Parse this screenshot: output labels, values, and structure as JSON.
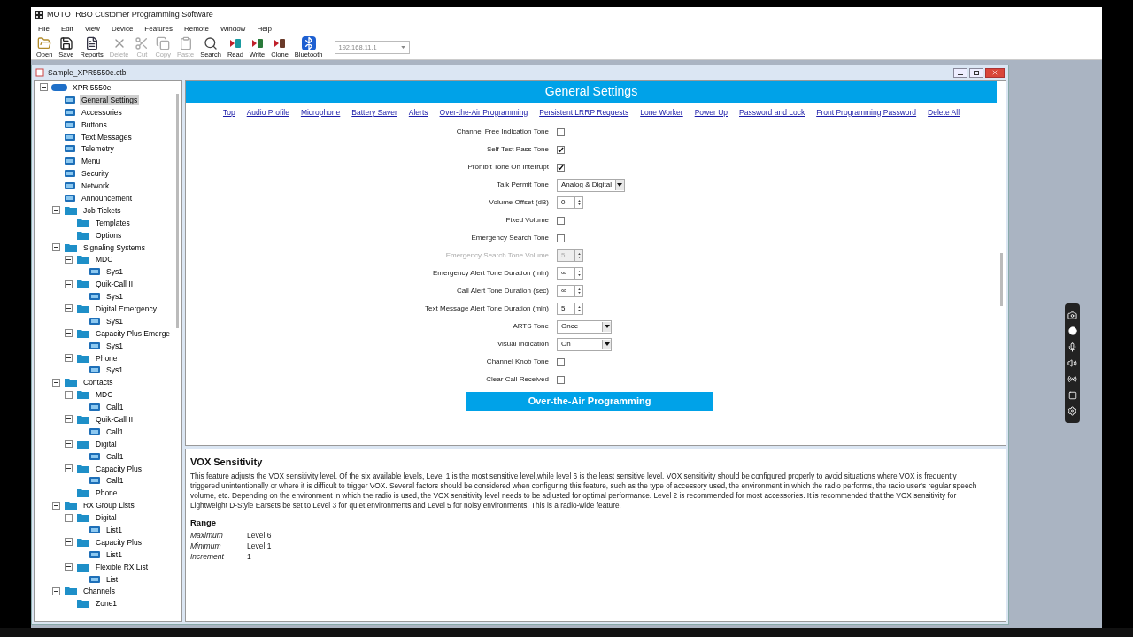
{
  "app": {
    "title": "MOTOTRBO Customer Programming Software"
  },
  "menu": [
    "File",
    "Edit",
    "View",
    "Device",
    "Features",
    "Remote",
    "Window",
    "Help"
  ],
  "toolbar": [
    {
      "label": "Open",
      "kind": "open",
      "disabled": false
    },
    {
      "label": "Save",
      "kind": "save",
      "disabled": false
    },
    {
      "label": "Reports",
      "kind": "reports",
      "disabled": false
    },
    {
      "label": "Delete",
      "kind": "delete",
      "disabled": true
    },
    {
      "label": "Cut",
      "kind": "cut",
      "disabled": true
    },
    {
      "label": "Copy",
      "kind": "copy",
      "disabled": true
    },
    {
      "label": "Paste",
      "kind": "paste",
      "disabled": true
    },
    {
      "label": "Search",
      "kind": "search",
      "disabled": false
    },
    {
      "label": "Read",
      "kind": "read",
      "disabled": false
    },
    {
      "label": "Write",
      "kind": "write",
      "disabled": false
    },
    {
      "label": "Clone",
      "kind": "clone",
      "disabled": false
    },
    {
      "label": "Bluetooth",
      "kind": "bluetooth",
      "disabled": false
    }
  ],
  "address": {
    "value": "192.168.11.1"
  },
  "document": {
    "title": "Sample_XPR5550e.ctb"
  },
  "tree": [
    {
      "label": "XPR 5550e",
      "kind": "radio",
      "selected": false,
      "children": [
        {
          "label": "General Settings",
          "kind": "item",
          "selected": true
        },
        {
          "label": "Accessories",
          "kind": "item",
          "selected": false
        },
        {
          "label": "Buttons",
          "kind": "item",
          "selected": false
        },
        {
          "label": "Text Messages",
          "kind": "item",
          "selected": false
        },
        {
          "label": "Telemetry",
          "kind": "item",
          "selected": false
        },
        {
          "label": "Menu",
          "kind": "item",
          "selected": false
        },
        {
          "label": "Security",
          "kind": "item",
          "selected": false
        },
        {
          "label": "Network",
          "kind": "item",
          "selected": false
        },
        {
          "label": "Announcement",
          "kind": "item",
          "selected": false
        },
        {
          "label": "Job Tickets",
          "kind": "folder",
          "selected": false,
          "children": [
            {
              "label": "Templates",
              "kind": "folder",
              "selected": false
            },
            {
              "label": "Options",
              "kind": "folder",
              "selected": false
            }
          ]
        },
        {
          "label": "Signaling Systems",
          "kind": "folder",
          "selected": false,
          "children": [
            {
              "label": "MDC",
              "kind": "folder",
              "selected": false,
              "children": [
                {
                  "label": "Sys1",
                  "kind": "item",
                  "selected": false
                }
              ]
            },
            {
              "label": "Quik-Call II",
              "kind": "folder",
              "selected": false,
              "children": [
                {
                  "label": "Sys1",
                  "kind": "item",
                  "selected": false
                }
              ]
            },
            {
              "label": "Digital Emergency",
              "kind": "folder",
              "selected": false,
              "children": [
                {
                  "label": "Sys1",
                  "kind": "item",
                  "selected": false
                }
              ]
            },
            {
              "label": "Capacity Plus Emerge",
              "kind": "folder",
              "selected": false,
              "children": [
                {
                  "label": "Sys1",
                  "kind": "item",
                  "selected": false
                }
              ]
            },
            {
              "label": "Phone",
              "kind": "folder",
              "selected": false,
              "children": [
                {
                  "label": "Sys1",
                  "kind": "item",
                  "selected": false
                }
              ]
            }
          ]
        },
        {
          "label": "Contacts",
          "kind": "folder",
          "selected": false,
          "children": [
            {
              "label": "MDC",
              "kind": "folder",
              "selected": false,
              "children": [
                {
                  "label": "Call1",
                  "kind": "item",
                  "selected": false
                }
              ]
            },
            {
              "label": "Quik-Call II",
              "kind": "folder",
              "selected": false,
              "children": [
                {
                  "label": "Call1",
                  "kind": "item",
                  "selected": false
                }
              ]
            },
            {
              "label": "Digital",
              "kind": "folder",
              "selected": false,
              "children": [
                {
                  "label": "Call1",
                  "kind": "item",
                  "selected": false
                }
              ]
            },
            {
              "label": "Capacity Plus",
              "kind": "folder",
              "selected": false,
              "children": [
                {
                  "label": "Call1",
                  "kind": "item",
                  "selected": false
                }
              ]
            },
            {
              "label": "Phone",
              "kind": "folder",
              "selected": false
            }
          ]
        },
        {
          "label": "RX Group Lists",
          "kind": "folder",
          "selected": false,
          "children": [
            {
              "label": "Digital",
              "kind": "folder",
              "selected": false,
              "children": [
                {
                  "label": "List1",
                  "kind": "item",
                  "selected": false
                }
              ]
            },
            {
              "label": "Capacity Plus",
              "kind": "folder",
              "selected": false,
              "children": [
                {
                  "label": "List1",
                  "kind": "item",
                  "selected": false
                }
              ]
            },
            {
              "label": "Flexible RX List",
              "kind": "folder",
              "selected": false,
              "children": [
                {
                  "label": "List",
                  "kind": "item",
                  "selected": false
                }
              ]
            }
          ]
        },
        {
          "label": "Channels",
          "kind": "folder",
          "selected": false,
          "children": [
            {
              "label": "Zone1",
              "kind": "folder",
              "selected": false
            }
          ]
        }
      ]
    }
  ],
  "page": {
    "title": "General Settings",
    "links": [
      "Top",
      "Audio Profile",
      "Microphone",
      "Battery Saver",
      "Alerts",
      "Over-the-Air Programming",
      "Persistent LRRP Requests",
      "Lone Worker",
      "Power Up",
      "Password and Lock",
      "Front Programming Password",
      "Delete All"
    ],
    "fields": [
      {
        "label": "Channel Free Indication Tone",
        "kind": "checkbox",
        "checked": false,
        "disabled": false
      },
      {
        "label": "Self Test Pass Tone",
        "kind": "checkbox",
        "checked": true,
        "disabled": false
      },
      {
        "label": "Prohibit Tone On Interrupt",
        "kind": "checkbox",
        "checked": true,
        "disabled": false
      },
      {
        "label": "Talk Permit Tone",
        "kind": "select",
        "value": "Analog & Digital",
        "disabled": false
      },
      {
        "label": "Volume Offset (dB)",
        "kind": "spin",
        "value": "0",
        "disabled": false
      },
      {
        "label": "Fixed Volume",
        "kind": "checkbox",
        "checked": false,
        "disabled": false
      },
      {
        "label": "Emergency Search Tone",
        "kind": "checkbox",
        "checked": false,
        "disabled": false
      },
      {
        "label": "Emergency Search Tone Volume",
        "kind": "spin",
        "value": "5",
        "disabled": true
      },
      {
        "label": "Emergency Alert Tone Duration (min)",
        "kind": "spin",
        "value": "∞",
        "disabled": false
      },
      {
        "label": "Call Alert Tone Duration (sec)",
        "kind": "spin",
        "value": "∞",
        "disabled": false
      },
      {
        "label": "Text Message Alert Tone Duration (min)",
        "kind": "spin",
        "value": "5",
        "disabled": false
      },
      {
        "label": "ARTS Tone",
        "kind": "select",
        "value": "Once",
        "disabled": false
      },
      {
        "label": "Visual Indication",
        "kind": "select",
        "value": "On",
        "disabled": false
      },
      {
        "label": "Channel Knob Tone",
        "kind": "checkbox",
        "checked": false,
        "disabled": false
      },
      {
        "label": "Clear Call Received",
        "kind": "checkbox",
        "checked": false,
        "disabled": false
      }
    ],
    "section": "Over-the-Air Programming"
  },
  "help": {
    "title": "VOX Sensitivity",
    "text": "This feature adjusts the VOX sensitivity level. Of the six available levels, Level 1 is the most sensitive level,while level 6 is the least sensitive level. VOX sensitivity should be configured properly to avoid situations where VOX is frequently triggered unintentionally or where it is difficult to trigger VOX. Several factors should be considered when configuring this feature, such as the type of accessory used, the environment in which the radio performs, the radio user's regular speech volume, etc.   Depending on the environment in which the radio is used, the VOX sensitivity level needs to be adjusted for optimal performance. Level 2 is recommended for most accessories. It is recommended that the VOX sensitivity for Lightweight D-Style Earsets be set to Level 3 for quiet environments and Level 5 for noisy environments.   This is a radio-wide feature.",
    "range_title": "Range",
    "range": [
      {
        "name": "Maximum",
        "value": "Level 6"
      },
      {
        "name": "Minimum",
        "value": "Level 1"
      },
      {
        "name": "Increment",
        "value": "1"
      }
    ]
  }
}
